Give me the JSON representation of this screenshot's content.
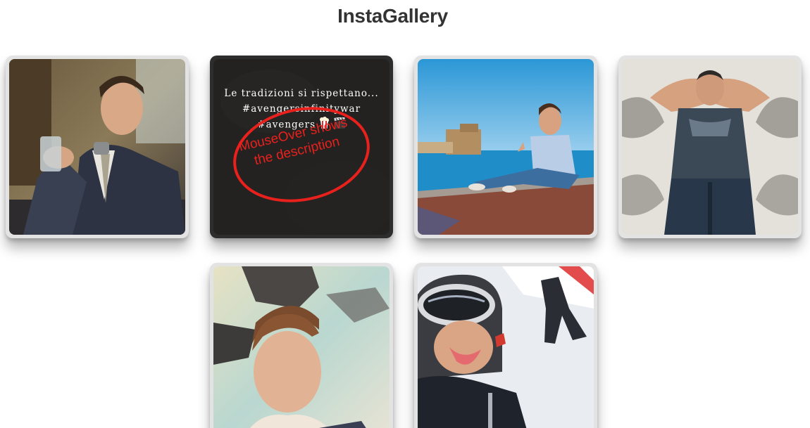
{
  "header": {
    "title": "InstaGallery"
  },
  "gallery": {
    "items": [
      {
        "name": "photo-restaurant-suit",
        "description": ""
      },
      {
        "name": "photo-avengers",
        "description_lines": [
          "Le tradizioni si rispettano...",
          "#avengersinfinitywar",
          "#avengers"
        ],
        "emoji": [
          "popcorn-icon",
          "clapper-board-icon"
        ]
      },
      {
        "name": "photo-seaside-castle",
        "description": ""
      },
      {
        "name": "photo-lying-down",
        "description": ""
      },
      {
        "name": "photo-rocks-selfie",
        "description": ""
      },
      {
        "name": "photo-ski-selfie",
        "description": ""
      }
    ]
  },
  "annotation": {
    "text_line1": "MouseOver shows",
    "text_line2": "the description",
    "color": "#e8211d"
  },
  "colors": {
    "title": "#333333",
    "card_frame": "#e3e3e3",
    "card_frame_hover": "#2d2d2d"
  }
}
